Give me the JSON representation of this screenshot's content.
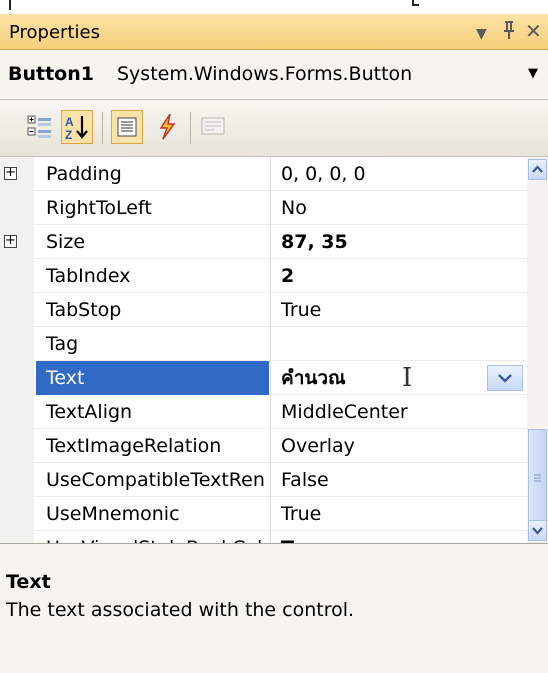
{
  "window": {
    "title": "Properties"
  },
  "object_selector": {
    "name": "Button1",
    "type": "System.Windows.Forms.Button"
  },
  "toolbar": {
    "buttons": [
      {
        "name": "categorized-button",
        "active": false
      },
      {
        "name": "alphabetical-button",
        "active": true
      },
      {
        "name": "properties-button",
        "active": true
      },
      {
        "name": "events-button",
        "active": false
      },
      {
        "name": "property-pages-button",
        "active": false,
        "disabled": true
      }
    ]
  },
  "properties": [
    {
      "name": "Padding",
      "value": "0, 0, 0, 0",
      "bold": false,
      "expandable": true
    },
    {
      "name": "RightToLeft",
      "value": "No",
      "bold": false,
      "expandable": false
    },
    {
      "name": "Size",
      "value": "87, 35",
      "bold": true,
      "expandable": true
    },
    {
      "name": "TabIndex",
      "value": "2",
      "bold": true,
      "expandable": false
    },
    {
      "name": "TabStop",
      "value": "True",
      "bold": false,
      "expandable": false
    },
    {
      "name": "Tag",
      "value": "",
      "bold": false,
      "expandable": false
    },
    {
      "name": "Text",
      "value": "คำนวณ",
      "bold": true,
      "expandable": false,
      "selected": true
    },
    {
      "name": "TextAlign",
      "value": "MiddleCenter",
      "bold": false,
      "expandable": false
    },
    {
      "name": "TextImageRelation",
      "value": "Overlay",
      "bold": false,
      "expandable": false
    },
    {
      "name": "UseCompatibleTextRen",
      "value": "False",
      "bold": false,
      "expandable": false
    },
    {
      "name": "UseMnemonic",
      "value": "True",
      "bold": false,
      "expandable": false
    },
    {
      "name": "UseVisualStyleBackColo",
      "value": "True",
      "bold": true,
      "expandable": false
    }
  ],
  "help": {
    "title": "Text",
    "description": "The text associated with the control."
  },
  "colors": {
    "selection": "#3169c6",
    "titlebar": "#f8d78e",
    "pane": "#f5f4ee"
  },
  "icons": [
    "dropdown-arrow-icon",
    "pin-icon",
    "close-icon",
    "expand-icon",
    "ibeam-cursor-icon",
    "scroll-up-icon",
    "scroll-down-icon"
  ]
}
